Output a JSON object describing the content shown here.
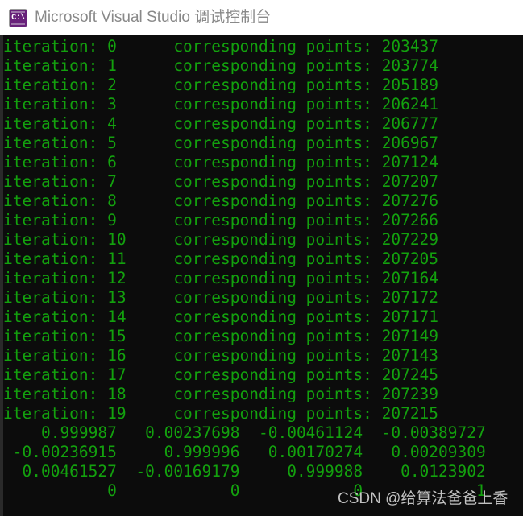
{
  "window": {
    "title": "Microsoft Visual Studio 调试控制台",
    "icon_name": "console-app-icon",
    "icon_glyph": "C:\\",
    "title_bar_bg": "#ffffff",
    "title_color": "#898989",
    "console_bg": "#0c0c0c",
    "console_fg": "#13a10e",
    "icon_bg": "#68217a"
  },
  "console": {
    "lines": [
      "iteration: 0      corresponding points: 203437",
      "iteration: 1      corresponding points: 203774",
      "iteration: 2      corresponding points: 205189",
      "iteration: 3      corresponding points: 206241",
      "iteration: 4      corresponding points: 206777",
      "iteration: 5      corresponding points: 206967",
      "iteration: 6      corresponding points: 207124",
      "iteration: 7      corresponding points: 207207",
      "iteration: 8      corresponding points: 207276",
      "iteration: 9      corresponding points: 207266",
      "iteration: 10     corresponding points: 207229",
      "iteration: 11     corresponding points: 207205",
      "iteration: 12     corresponding points: 207164",
      "iteration: 13     corresponding points: 207172",
      "iteration: 14     corresponding points: 207171",
      "iteration: 15     corresponding points: 207149",
      "iteration: 16     corresponding points: 207143",
      "iteration: 17     corresponding points: 207245",
      "iteration: 18     corresponding points: 207239",
      "iteration: 19     corresponding points: 207215",
      "    0.999987   0.00237698  -0.00461124  -0.00389727",
      " -0.00236915     0.999996   0.00170274   0.00209309",
      "  0.00461527  -0.00169179     0.999988    0.0123902",
      "           0            0            0            1"
    ],
    "iterations": [
      {
        "iteration": 0,
        "corresponding_points": 203437
      },
      {
        "iteration": 1,
        "corresponding_points": 203774
      },
      {
        "iteration": 2,
        "corresponding_points": 205189
      },
      {
        "iteration": 3,
        "corresponding_points": 206241
      },
      {
        "iteration": 4,
        "corresponding_points": 206777
      },
      {
        "iteration": 5,
        "corresponding_points": 206967
      },
      {
        "iteration": 6,
        "corresponding_points": 207124
      },
      {
        "iteration": 7,
        "corresponding_points": 207207
      },
      {
        "iteration": 8,
        "corresponding_points": 207276
      },
      {
        "iteration": 9,
        "corresponding_points": 207266
      },
      {
        "iteration": 10,
        "corresponding_points": 207229
      },
      {
        "iteration": 11,
        "corresponding_points": 207205
      },
      {
        "iteration": 12,
        "corresponding_points": 207164
      },
      {
        "iteration": 13,
        "corresponding_points": 207172
      },
      {
        "iteration": 14,
        "corresponding_points": 207171
      },
      {
        "iteration": 15,
        "corresponding_points": 207149
      },
      {
        "iteration": 16,
        "corresponding_points": 207143
      },
      {
        "iteration": 17,
        "corresponding_points": 207245
      },
      {
        "iteration": 18,
        "corresponding_points": 207239
      },
      {
        "iteration": 19,
        "corresponding_points": 207215
      }
    ],
    "transform_matrix": [
      [
        "0.999987",
        "0.00237698",
        "-0.00461124",
        "-0.00389727"
      ],
      [
        "-0.00236915",
        "0.999996",
        "0.00170274",
        "0.00209309"
      ],
      [
        "0.00461527",
        "-0.00169179",
        "0.999988",
        "0.0123902"
      ],
      [
        "0",
        "0",
        "0",
        "1"
      ]
    ]
  },
  "watermark": {
    "text": "CSDN @给算法爸爸上香"
  }
}
